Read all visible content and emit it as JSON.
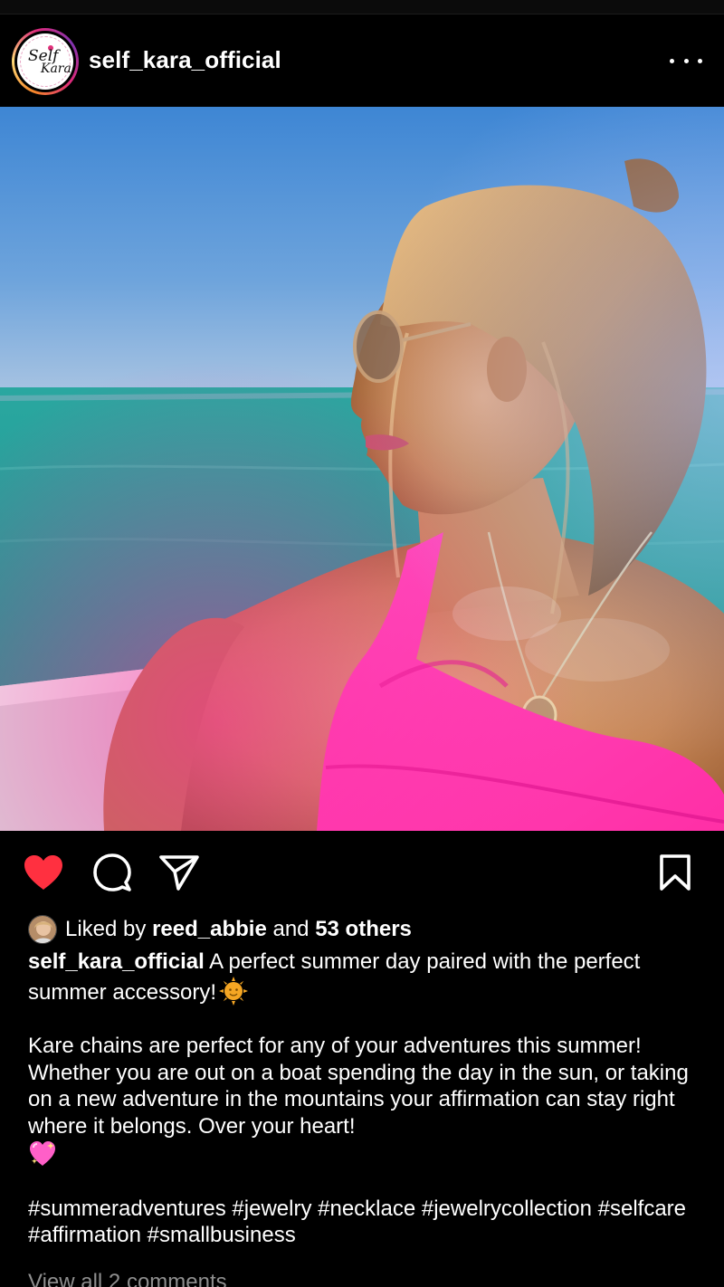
{
  "post": {
    "username": "self_kara_official",
    "avatar_logo_line1": "Self",
    "avatar_logo_line2": "Kara",
    "more_icon": "ellipsis-icon",
    "photo_alt": "photo"
  },
  "actions": {
    "like_icon": "heart-filled-icon",
    "comment_icon": "comment-bubble-icon",
    "share_icon": "paper-plane-icon",
    "save_icon": "bookmark-icon",
    "like_color": "#ff3040"
  },
  "likes": {
    "prefix": "Liked by",
    "user": "reed_abbie",
    "conjunction": "and",
    "others": "53 others"
  },
  "caption": {
    "username": "self_kara_official",
    "line1": "A perfect summer day paired with the perfect summer accessory!",
    "paragraph2": "Kare chains are perfect for any of your adventures this summer! Whether you are out on a boat spending the day in the sun, or taking on a new adventure in the mountains your affirmation can stay right where it belongs. Over your heart!",
    "hashtags": "#summeradventures #jewelry #necklace #jewelrycollection #selfcare #affirmation #smallbusiness"
  },
  "comments": {
    "view_all": "View all 2 comments"
  },
  "colors": {
    "background": "#000000",
    "text": "#ffffff",
    "muted": "#8e8e8e"
  }
}
